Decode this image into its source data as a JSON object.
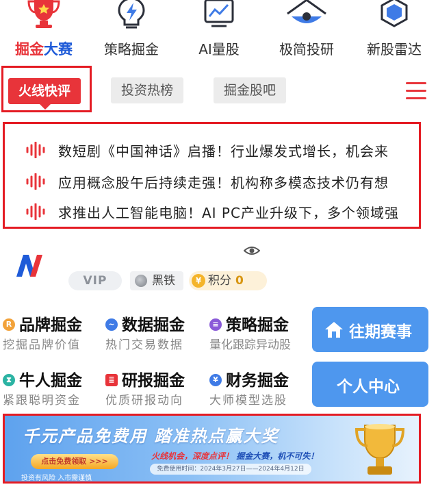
{
  "nav": {
    "items": [
      {
        "label_a": "掘金",
        "label_b": "大赛",
        "icon": "trophy-icon"
      },
      {
        "label": "策略掘金",
        "icon": "lightning-bulb-icon"
      },
      {
        "label": "AI量股",
        "icon": "chart-board-icon"
      },
      {
        "label": "极简投研",
        "icon": "radar-eye-icon"
      },
      {
        "label": "新股雷达",
        "icon": "hexagon-shield-icon"
      }
    ],
    "accent": "#e8343a",
    "secondary_accent": "#1f5bd8"
  },
  "tabs": {
    "active": "火线快评",
    "others": [
      "投资热榜",
      "掘金股吧"
    ],
    "menu_icon": "hamburger-menu-icon"
  },
  "news": [
    {
      "text": "数短剧《中国神话》启播！行业爆发式增长，机会来"
    },
    {
      "text": "应用概念股午后持续走强！机构称多模态技术仍有想"
    },
    {
      "text": "求推出人工智能电脑！AI PC产业升级下，多个领域强"
    }
  ],
  "profile": {
    "vip": "VIP",
    "rank": "黑铁",
    "points_label": "积分",
    "points_value": "0",
    "points_icon_glyph": "¥"
  },
  "features": [
    {
      "title": "品牌掘金",
      "sub": "挖掘品牌价值",
      "icon": "brand-r-icon",
      "color": "#f2a23a",
      "glyph": "R"
    },
    {
      "title": "数据掘金",
      "sub": "热门交易数据",
      "icon": "data-pulse-icon",
      "color": "#3f7be6",
      "glyph": "~"
    },
    {
      "title": "策略掘金",
      "sub": "量化跟踪异动股",
      "icon": "stack-layers-icon",
      "color": "#8a5ad8",
      "glyph": "≡"
    },
    {
      "title": "牛人掘金",
      "sub": "紧跟聪明资金",
      "icon": "hourglass-icon",
      "color": "#2bb3a3",
      "glyph": "⧗"
    },
    {
      "title": "研报掘金",
      "sub": "优质研报动向",
      "icon": "report-doc-icon",
      "color": "#e8343a",
      "glyph": "≣"
    },
    {
      "title": "财务掘金",
      "sub": "大师模型选股",
      "icon": "yen-coin-icon",
      "color": "#3f7be6",
      "glyph": "¥"
    }
  ],
  "side_buttons": {
    "past": "往期赛事",
    "personal": "个人中心"
  },
  "banner": {
    "headline": "千元产品免费用  踏准热点赢大奖",
    "cta": "点击免费领取 >>>",
    "slogan_red": "火线机会，深度点评！",
    "slogan_blue": "掘金大赛，机不可失！",
    "date": "免费使用时间：2024年3月27日——2024年4月12日",
    "risk": "投资有风险  入市需谨慎"
  }
}
